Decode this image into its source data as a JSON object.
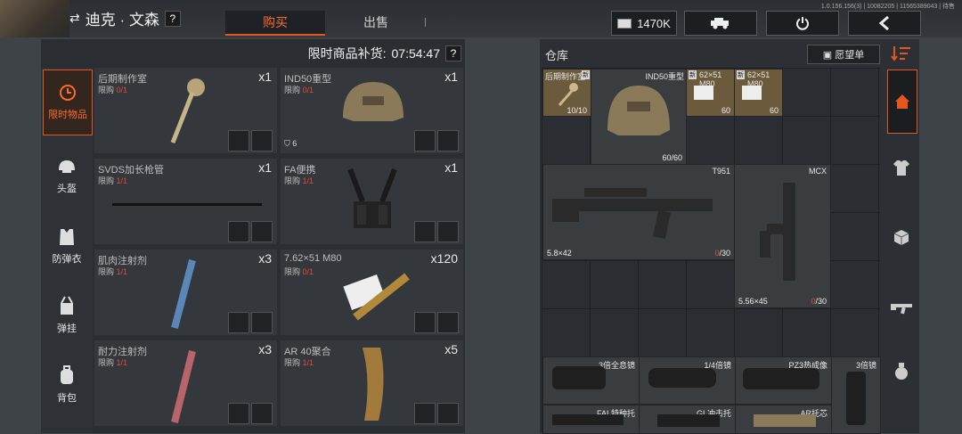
{
  "header": {
    "player_name": "迪克 · 文森",
    "help": "?",
    "tabs": [
      {
        "label": "购买",
        "active": true
      },
      {
        "label": "出售",
        "active": false
      }
    ],
    "currency": "1470K",
    "version": "1.0.156.156(3) | 10082205 | 11565389043 | 待售"
  },
  "restock": {
    "label": "限时商品补货:",
    "timer": "07:54:47",
    "help": "?"
  },
  "categories": [
    {
      "label": "限时物品",
      "icon": "clock-icon",
      "active": true
    },
    {
      "label": "头盔",
      "icon": "helmet-icon",
      "active": false
    },
    {
      "label": "防弹衣",
      "icon": "vest-icon",
      "active": false
    },
    {
      "label": "弹挂",
      "icon": "rig-icon",
      "active": false
    },
    {
      "label": "背包",
      "icon": "backpack-icon",
      "active": false
    }
  ],
  "shop_items": [
    {
      "name": "后期制作室",
      "limit_label": "限购",
      "limit": "0/1",
      "qty": "x1"
    },
    {
      "name": "IND50重型",
      "limit_label": "限购",
      "limit": "0/1",
      "qty": "x1",
      "armor": "6"
    },
    {
      "name": "SVDS加长枪管",
      "limit_label": "限购",
      "limit": "1/1",
      "qty": "x1"
    },
    {
      "name": "FA便携",
      "limit_label": "限购",
      "limit": "1/1",
      "qty": "x1"
    },
    {
      "name": "肌肉注射剂",
      "limit_label": "限购",
      "limit": "1/1",
      "qty": "x3"
    },
    {
      "name": "7.62×51 M80",
      "limit_label": "限购",
      "limit": "0/1",
      "qty": "x120"
    },
    {
      "name": "耐力注射剂",
      "limit_label": "限购",
      "limit": "1/1",
      "qty": "x3"
    },
    {
      "name": "AR 40聚合",
      "limit_label": "限购",
      "limit": "1/1",
      "qty": "x5"
    }
  ],
  "warehouse": {
    "title": "仓库",
    "wishlist": "愿望单",
    "slots": [
      {
        "name": "后期制作室",
        "count": "10/10",
        "new": "新"
      },
      {
        "name": "IND50重型",
        "count": "60/60"
      },
      {
        "name": "62×51 M80",
        "count": "60",
        "new": "新"
      },
      {
        "name": "62×51 M80",
        "count": "60",
        "new": "新"
      }
    ],
    "weapons": [
      {
        "name": "T951",
        "caliber": "5.8×42",
        "ammo_cur": "0",
        "ammo_max": "/30"
      },
      {
        "name": "MCX",
        "caliber": "5.56×45",
        "ammo_cur": "0",
        "ammo_max": "/30"
      }
    ],
    "attachments": [
      "3倍全息镜",
      "1/4倍镜",
      "PZ3热成像",
      "3倍镜",
      "FAL特种托",
      "GL冲击托",
      "AR托芯"
    ]
  },
  "right_nav": [
    "home-icon",
    "shirt-icon",
    "box-icon",
    "rifle-icon",
    "grenade-icon"
  ],
  "colors": {
    "accent": "#e5561d",
    "limit_red": "#e34a3a"
  }
}
